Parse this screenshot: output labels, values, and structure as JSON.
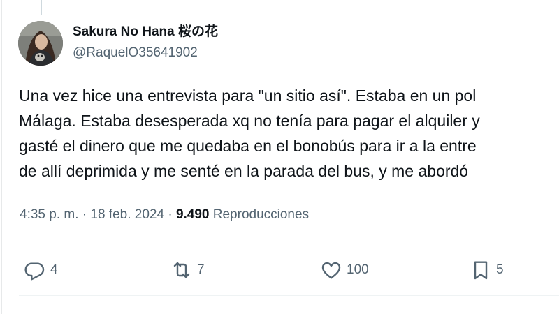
{
  "author": {
    "display_name": "Sakura No Hana 桜の花",
    "handle": "@RaquelO35641902"
  },
  "tweet": {
    "lines": [
      "Una vez hice una entrevista para \"un sitio así\". Estaba en un pol",
      "Málaga. Estaba desesperada xq no tenía para pagar el alquiler y",
      "gasté el dinero que me quedaba en el bonobús para ir a la entre",
      "de allí deprimida y me senté en la parada del bus, y me abordó"
    ]
  },
  "meta": {
    "time": "4:35 p. m.",
    "separator1": "·",
    "date": "18 feb. 2024",
    "separator2": "·",
    "views_count": "9.490",
    "views_label": "Reproducciones"
  },
  "actions": {
    "replies": "4",
    "reposts": "7",
    "likes": "100",
    "bookmarks": "5"
  },
  "icons": {
    "reply": "reply-icon",
    "repost": "repost-icon",
    "like": "heart-icon",
    "bookmark": "bookmark-icon"
  },
  "colors": {
    "text": "#0f1419",
    "secondary": "#536471",
    "divider": "#eff3f4"
  }
}
